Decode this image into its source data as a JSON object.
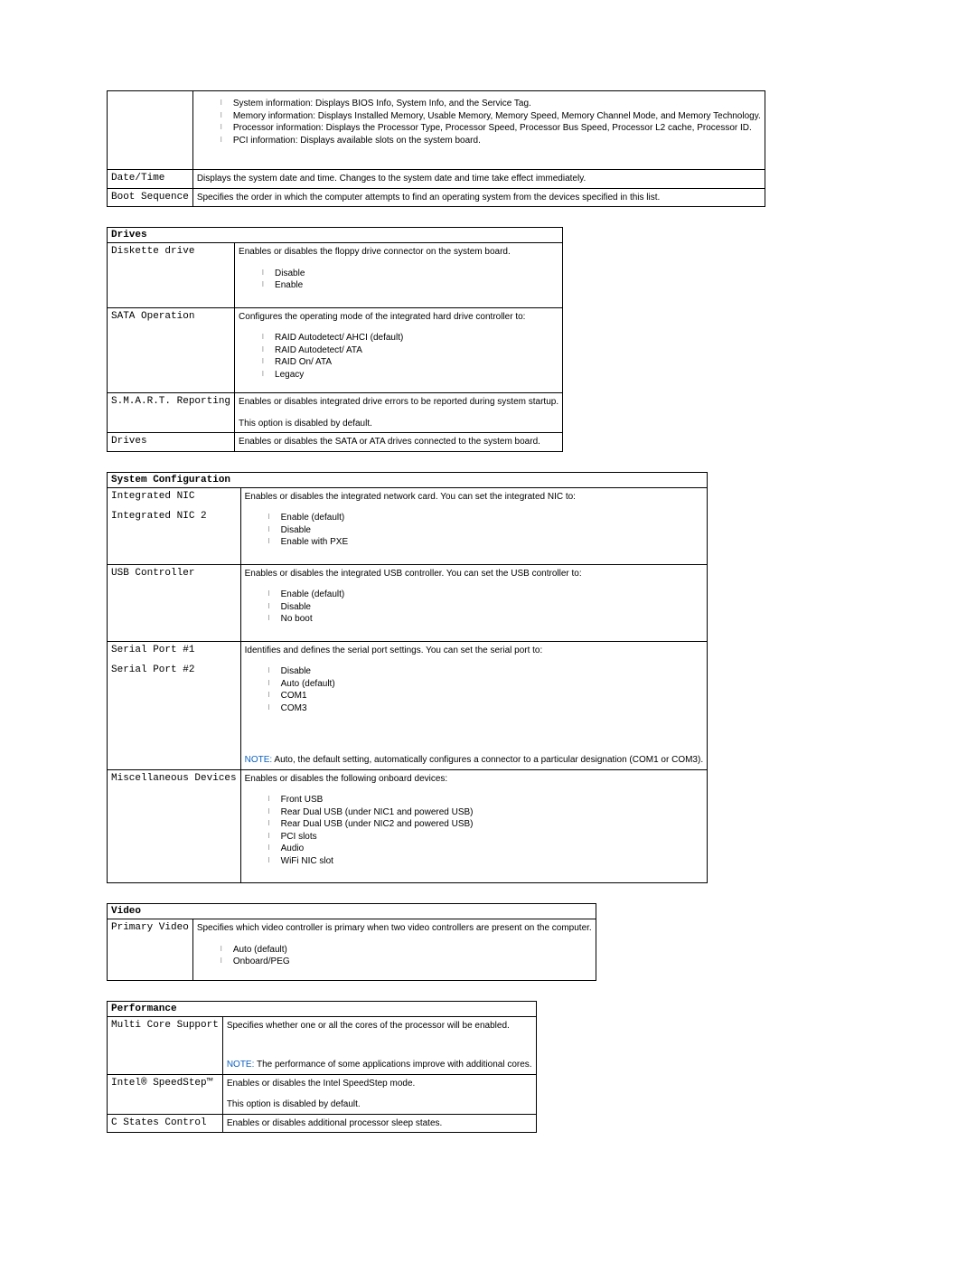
{
  "table1": {
    "row0_bullets": [
      "System information: Displays BIOS Info, System Info, and the Service Tag.",
      "Memory information: Displays Installed Memory, Usable Memory, Memory Speed, Memory Channel Mode, and Memory Technology.",
      "Processor information: Displays the Processor Type, Processor Speed, Processor Bus Speed, Processor L2 cache, Processor ID.",
      "PCI information: Displays available slots on the system board."
    ],
    "row1_label": "Date/Time",
    "row1_text": "Displays the system date and time. Changes to the system date and time take effect immediately.",
    "row2_label": "Boot Sequence",
    "row2_text": "Specifies the order in which the computer attempts to find an operating system from the devices specified in this list."
  },
  "drives": {
    "header": "Drives",
    "diskette_label": "Diskette drive",
    "diskette_text": "Enables or disables the floppy drive connector on the system board.",
    "diskette_bullets": [
      "Disable",
      "Enable"
    ],
    "sata_label": "SATA Operation",
    "sata_text": "Configures the operating mode of the integrated hard drive controller to:",
    "sata_bullets": [
      "RAID Autodetect/ AHCI (default)",
      "RAID Autodetect/ ATA",
      "RAID On/ ATA",
      "Legacy"
    ],
    "smart_label": "S.M.A.R.T. Reporting",
    "smart_text1": "Enables or disables integrated drive errors to be reported during system startup.",
    "smart_text2": "This option is disabled by default.",
    "drives_label": "Drives",
    "drives_text": "Enables or disables the SATA or ATA drives connected to the system board."
  },
  "sysconfig": {
    "header": "System Configuration",
    "nic_label1": "Integrated NIC",
    "nic_label2": "Integrated NIC 2",
    "nic_text": "Enables or disables the integrated network card. You can set the integrated NIC to:",
    "nic_bullets": [
      "Enable (default)",
      "Disable",
      "Enable with PXE"
    ],
    "usb_label": "USB Controller",
    "usb_text": "Enables or disables the integrated USB controller. You can set the USB controller to:",
    "usb_bullets": [
      "Enable (default)",
      "Disable",
      "No boot"
    ],
    "serial_label1": "Serial Port #1",
    "serial_label2": "Serial Port #2",
    "serial_text": "Identifies and defines the serial port settings. You can set the serial port to:",
    "serial_bullets": [
      "Disable",
      "Auto (default)",
      "COM1",
      "COM3"
    ],
    "serial_note_prefix": "NOTE:",
    "serial_note_text": " Auto, the default setting, automatically configures a connector to a particular designation (COM1 or COM3).",
    "misc_label": "Miscellaneous Devices",
    "misc_text": "Enables or disables the following onboard devices:",
    "misc_bullets": [
      "Front USB",
      "Rear Dual USB (under NIC1 and powered USB)",
      "Rear Dual USB (under NIC2 and powered USB)",
      "PCI slots",
      "Audio",
      "WiFi NIC slot"
    ]
  },
  "video": {
    "header": "Video",
    "pv_label": "Primary Video",
    "pv_text": "Specifies which video controller is primary when two video controllers are present on the computer.",
    "pv_bullets": [
      "Auto (default)",
      "Onboard/PEG"
    ]
  },
  "performance": {
    "header": "Performance",
    "mc_label": "Multi Core Support",
    "mc_text": "Specifies whether one or all the cores of the processor will be enabled.",
    "mc_note_prefix": "NOTE:",
    "mc_note_text": " The performance of some applications improve with additional cores.",
    "ss_label": "Intel® SpeedStep™",
    "ss_text1": "Enables or disables the Intel SpeedStep mode.",
    "ss_text2": "This option is disabled by default.",
    "cs_label": "C States Control",
    "cs_text": "Enables or disables additional processor sleep states."
  }
}
